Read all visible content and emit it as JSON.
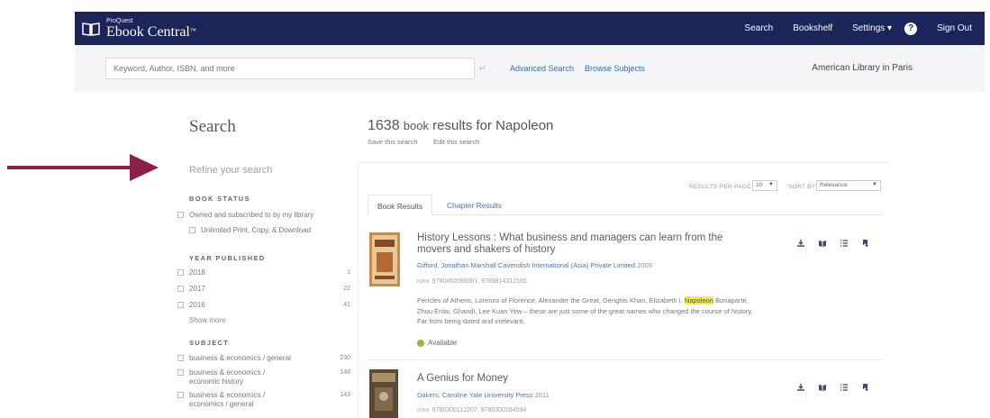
{
  "header": {
    "brand_small": "ProQuest",
    "brand_name": "Ebook Central",
    "brand_tm": "™",
    "nav": {
      "search": "Search",
      "bookshelf": "Bookshelf",
      "settings": "Settings ▾",
      "help_icon": "?",
      "sign_out": "Sign Out"
    }
  },
  "searchbar": {
    "placeholder": "Keyword, Author, ISBN, and more",
    "go_icon": "↵",
    "advanced_search": "Advanced Search",
    "browse_subjects": "Browse Subjects",
    "library": "American Library in Paris"
  },
  "sidebar": {
    "title": "Search",
    "refine": "Refine your search",
    "book_status": {
      "heading": "BOOK STATUS",
      "owned": "Owned and subscribed to by my library",
      "unlimited": "Unlimited Print, Copy, & Download"
    },
    "year_published": {
      "heading": "YEAR PUBLISHED",
      "items": [
        {
          "label": "2018",
          "count": "1"
        },
        {
          "label": "2017",
          "count": "22"
        },
        {
          "label": "2016",
          "count": "41"
        }
      ],
      "show_more": "Show more"
    },
    "subject": {
      "heading": "SUBJECT",
      "items": [
        {
          "label": "business & economics / general",
          "count": "230"
        },
        {
          "label": "business & economics / economic history",
          "count": "148"
        },
        {
          "label": "business & economics / economics / general",
          "count": "143"
        }
      ]
    }
  },
  "results": {
    "count": "1638",
    "text_book": "book",
    "text_results": "results for Napoleon",
    "save_search": "Save this search",
    "edit_search": "Edit this search",
    "per_page_label": "RESULTS PER PAGE",
    "per_page_value": "10",
    "sort_label": "SORT BY",
    "sort_value": "Relevance",
    "tab_books": "Book Results",
    "tab_chapters": "Chapter Results",
    "items": [
      {
        "title": "History Lessons : What business and managers can learn from the movers and shakers of history",
        "author": "Gifford, Jonathan",
        "publisher": "Marshall Cavendish International (Asia) Private Limited",
        "year": "2009",
        "isbn_label": "ISBN",
        "isbn": "9780462099361, 9789814312165",
        "desc_before": "Pericles of Athens, Lorenzo of Florence, Alexander the Great, Genghis Khan, Elizabeth I,",
        "desc_highlight": "Napoleon",
        "desc_after": "Bonaparte, Zhou Enlai, Ghandi, Lee Kuan Yew – these are just some of the great names who changed the course of history. Far from being dated and irrelevant,",
        "availability": "Available"
      },
      {
        "title": "A Genius for Money",
        "author": "Dakers, Caroline",
        "publisher": "Yale University Press",
        "year": "2011",
        "isbn_label": "ISBN",
        "isbn": "9780300112207, 9780300184594"
      }
    ]
  },
  "colors": {
    "nav_bg": "#1b2559",
    "arrow": "#8e1f4b",
    "link": "#4a76b0",
    "available": "#95b83e",
    "highlight": "#f3ee3a"
  }
}
